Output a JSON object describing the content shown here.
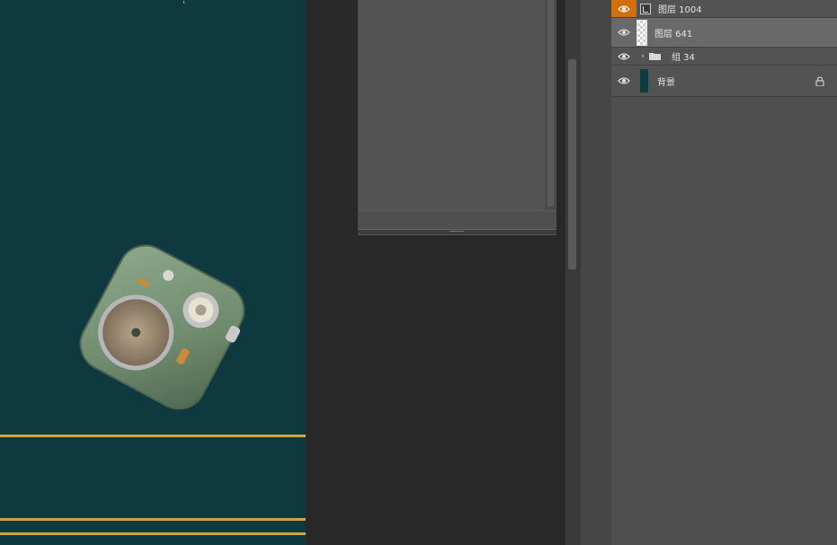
{
  "layers_panel": {
    "layers": [
      {
        "name": "图层 1004",
        "visible": true,
        "type": "smart-object"
      },
      {
        "name": "图层 641",
        "visible": true,
        "type": "pixel",
        "selected": true
      },
      {
        "name": "组 34",
        "visible": true,
        "type": "group",
        "collapsed": true
      },
      {
        "name": "背景",
        "visible": true,
        "type": "background",
        "locked": true
      }
    ]
  },
  "canvas": {
    "background_color": "#0e3a3f",
    "accent_line_color": "#cfa443",
    "product_icon": "vintage-radio-speaker"
  },
  "colors": {
    "active_eye": "#cf6f0e",
    "selected_row": "#696969"
  }
}
